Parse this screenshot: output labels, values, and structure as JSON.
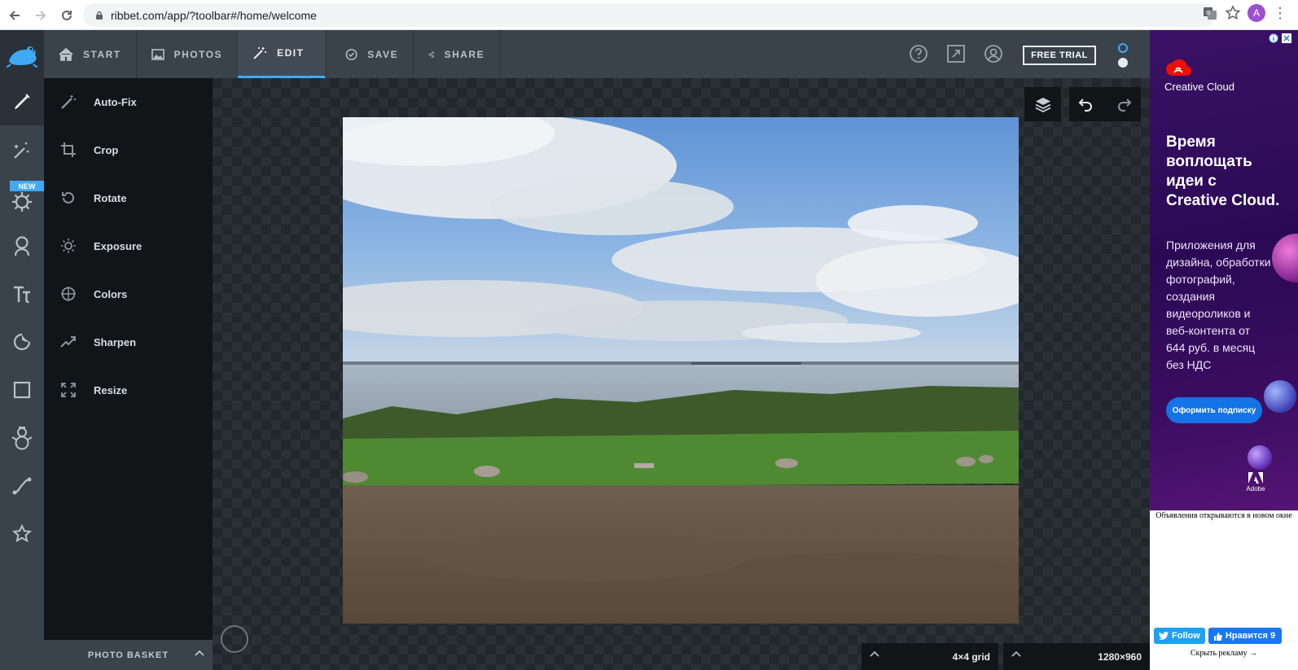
{
  "browser": {
    "url": "ribbet.com/app/?toolbar#/home/welcome",
    "avatar_letter": "A"
  },
  "header": {
    "tabs": [
      {
        "label": "START",
        "icon": "home-icon"
      },
      {
        "label": "PHOTOS",
        "icon": "image-icon"
      },
      {
        "label": "EDIT",
        "icon": "magic-wand-icon",
        "active": true
      },
      {
        "label": "SAVE",
        "icon": "check-circle-icon"
      },
      {
        "label": "SHARE",
        "icon": "share-icon"
      }
    ],
    "free_trial_label": "FREE TRIAL"
  },
  "rail": {
    "new_badge": "NEW",
    "icons": [
      "pencil-icon",
      "effects-wand-icon",
      "gear-sun-icon",
      "portrait-icon",
      "text-tt-icon",
      "sticker-icon",
      "frame-square-icon",
      "snowman-icon",
      "curve-icon",
      "star-icon"
    ]
  },
  "tools": {
    "items": [
      {
        "label": "Auto-Fix",
        "icon": "auto-fix-icon"
      },
      {
        "label": "Crop",
        "icon": "crop-icon"
      },
      {
        "label": "Rotate",
        "icon": "rotate-icon"
      },
      {
        "label": "Exposure",
        "icon": "exposure-icon"
      },
      {
        "label": "Colors",
        "icon": "colors-icon"
      },
      {
        "label": "Sharpen",
        "icon": "sharpen-icon"
      },
      {
        "label": "Resize",
        "icon": "resize-icon"
      }
    ],
    "photo_basket_label": "PHOTO BASKET"
  },
  "canvas": {
    "grid_label": "4×4  grid",
    "dimensions_label": "1280×960"
  },
  "ad": {
    "brand": "Creative Cloud",
    "headline": "Время воплощать идеи с Creative Cloud.",
    "body": "Приложения для дизайна, обработки фотографий, создания видеороликов и веб-контента от 644 руб. в месяц без НДС",
    "cta": "Оформить подписку",
    "adobe_label": "Adobe",
    "note": "Объявления открываются в новом окне",
    "follow": "Follow",
    "like": "Нравится 9",
    "hide": "Скрыть рекламу →"
  },
  "colors": {
    "accent": "#3fa9f5",
    "header_bg": "#3a424b",
    "panel_bg": "#111518"
  }
}
